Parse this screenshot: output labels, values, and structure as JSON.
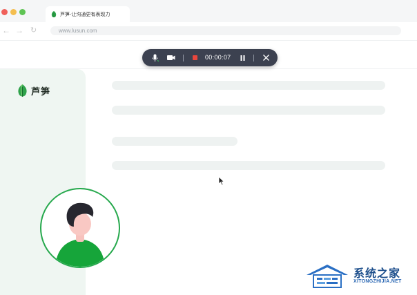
{
  "browser": {
    "tab_title": "芦笋-让沟通更有表现力",
    "url": "www.lusun.com",
    "traffic_lights": [
      "#f0605a",
      "#f4be4f",
      "#5fc454"
    ]
  },
  "recorder": {
    "timer": "00:00:07",
    "icons": [
      "microphone-icon",
      "camera-icon",
      "stop-record-icon",
      "pause-icon",
      "close-icon"
    ],
    "stop_color": "#e8463d"
  },
  "sidebar": {
    "brand_name": "芦笋",
    "brand_color": "#2ea24a"
  },
  "watermark": {
    "cn": "系统之家",
    "en": "XITONGZHIJIA.NET"
  },
  "colors": {
    "accent": "#25a84c",
    "recbar_bg": "#3c4150"
  }
}
